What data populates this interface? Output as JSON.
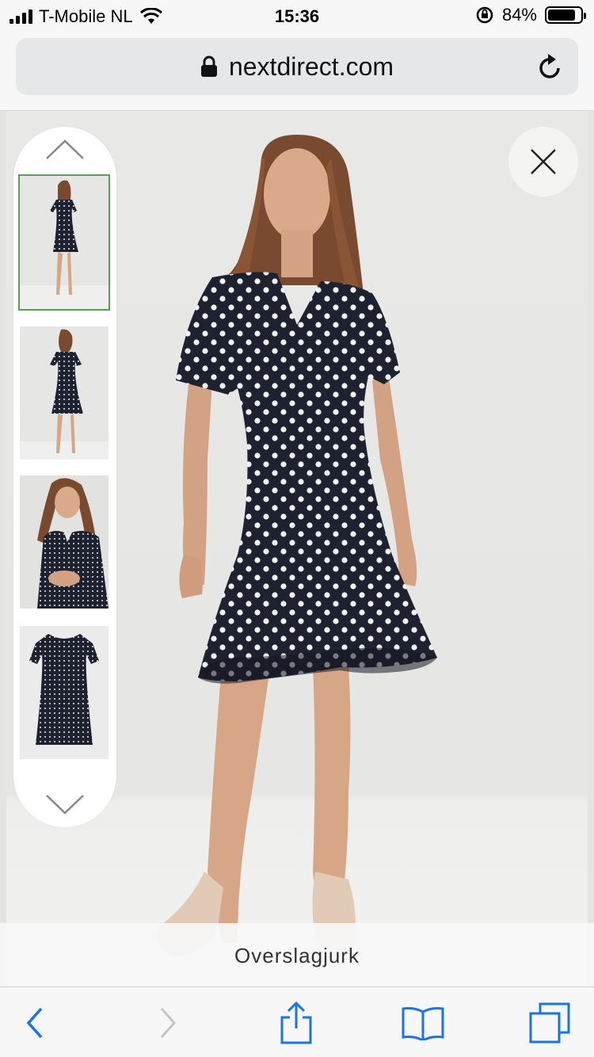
{
  "status": {
    "carrier": "T-Mobile NL",
    "time": "15:36",
    "battery_pct": "84%",
    "battery_level": 0.84
  },
  "browser": {
    "address": "nextdirect.com",
    "lock_icon": "lock-icon",
    "reload_icon": "reload-icon"
  },
  "gallery": {
    "thumbnails": [
      {
        "name": "thumb-front-full",
        "active": true
      },
      {
        "name": "thumb-back-full",
        "active": false
      },
      {
        "name": "thumb-closeup",
        "active": false
      },
      {
        "name": "thumb-flat",
        "active": false
      }
    ],
    "caption": "Overslagjurk"
  },
  "toolbar": {
    "icons": [
      "back-icon",
      "forward-icon",
      "share-icon",
      "bookmarks-icon",
      "tabs-icon"
    ]
  },
  "colors": {
    "accent": "#1a73e8",
    "active_thumb_border": "#5d9a5c",
    "dress": "#1e2230"
  }
}
